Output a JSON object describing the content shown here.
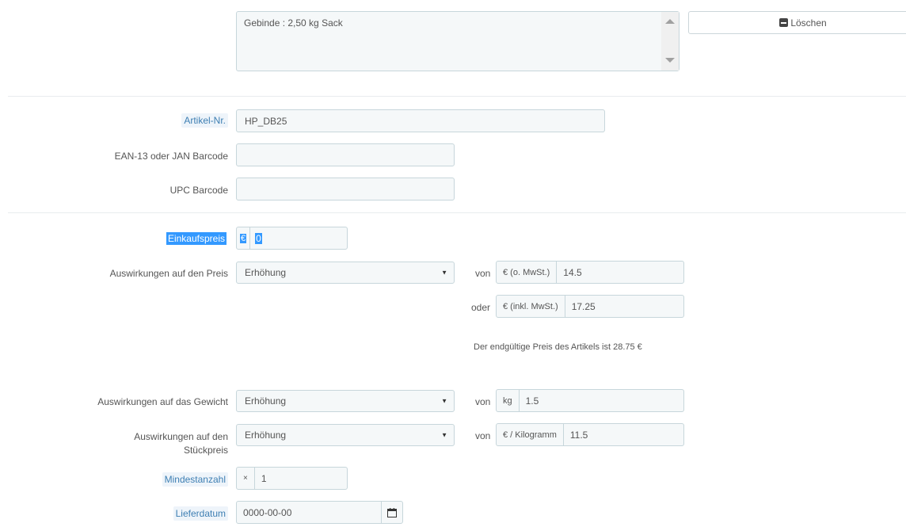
{
  "description_box": {
    "text": "Gebinde : 2,50 kg Sack"
  },
  "delete_button": {
    "label": "Löschen",
    "icon": "minus-square-icon"
  },
  "fields": {
    "reference": {
      "label": "Artikel-Nr.",
      "value": "HP_DB25"
    },
    "ean13": {
      "label": "EAN-13 oder JAN Barcode",
      "value": ""
    },
    "upc": {
      "label": "UPC Barcode",
      "value": ""
    },
    "wholesale": {
      "label": "Einkaufspreis",
      "currency": "€",
      "value": "0"
    },
    "price_impact": {
      "label": "Auswirkungen auf den Preis",
      "selected": "Erhöhung",
      "von_label": "von",
      "oder_label": "oder",
      "tax_excl_unit": "€ (o. MwSt.)",
      "tax_excl_value": "14.5",
      "tax_incl_unit": "€ (inkl. MwSt.)",
      "tax_incl_value": "17.25",
      "final_price_text": "Der endgültige Preis des Artikels ist 28.75 €"
    },
    "weight_impact": {
      "label": "Auswirkungen auf das Gewicht",
      "selected": "Erhöhung",
      "von_label": "von",
      "unit": "kg",
      "value": "1.5"
    },
    "unit_price_impact": {
      "label_line1": "Auswirkungen auf den",
      "label_line2": "Stückpreis",
      "selected": "Erhöhung",
      "von_label": "von",
      "unit": "€ / Kilogramm",
      "value": "11.5"
    },
    "minimal_quantity": {
      "label": "Mindestanzahl",
      "prefix": "×",
      "value": "1"
    },
    "available_date": {
      "label": "Lieferdatum",
      "value": "0000-00-00"
    }
  },
  "colors": {
    "input_bg": "#f5f8f9",
    "input_border": "#c7d6db",
    "label_highlight_bg": "#eef4fa",
    "label_highlight_text": "#3e7fb3",
    "selection": "#3399ff"
  }
}
